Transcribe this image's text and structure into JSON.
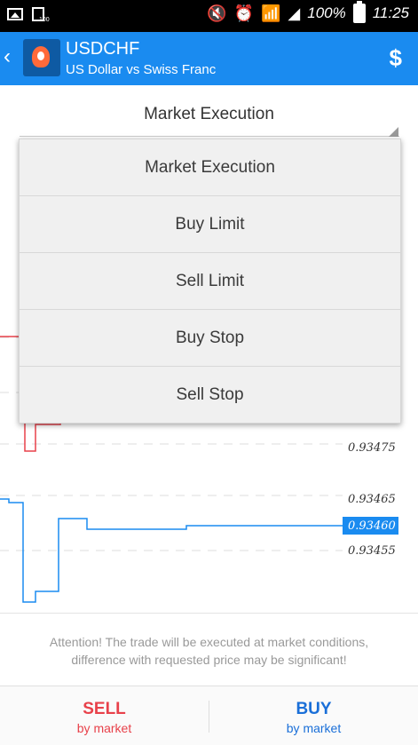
{
  "status_bar": {
    "small_label": "100",
    "battery_percent": "100%",
    "time": "11:25"
  },
  "header": {
    "symbol": "USDCHF",
    "description": "US Dollar vs Swiss Franc",
    "trade_icon": "currency-exchange-icon"
  },
  "order": {
    "selected_type": "Market Execution",
    "options": [
      "Market Execution",
      "Buy Limit",
      "Sell Limit",
      "Buy Stop",
      "Sell Stop"
    ]
  },
  "chart": {
    "price_labels": [
      "0.93475",
      "0.93465",
      "0.93460",
      "0.93455"
    ],
    "current_price": "0.93460",
    "ask_color": "#e8414a",
    "bid_color": "#1a8bf0"
  },
  "attention": {
    "line1": "Attention! The trade will be executed at market conditions,",
    "line2": "difference with requested price may be significant!"
  },
  "actions": {
    "sell_label": "SELL",
    "sell_sub": "by market",
    "buy_label": "BUY",
    "buy_sub": "by market"
  }
}
